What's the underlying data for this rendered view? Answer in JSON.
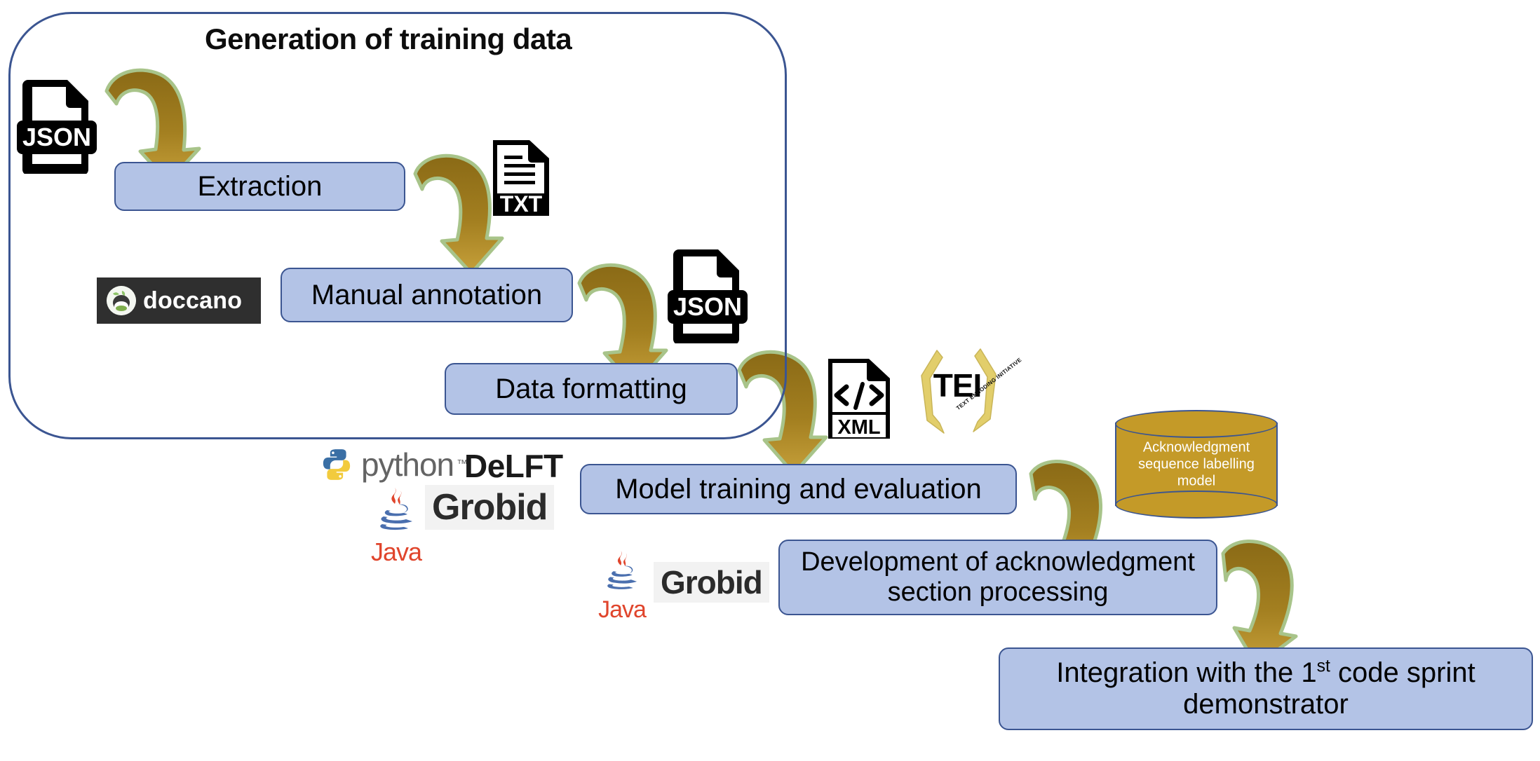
{
  "diagram": {
    "title": "Generation of training data",
    "group": {
      "label": "Generation of training data"
    },
    "steps": [
      {
        "id": "extraction",
        "label": "Extraction"
      },
      {
        "id": "manual-annotation",
        "label": "Manual annotation"
      },
      {
        "id": "data-formatting",
        "label": "Data formatting"
      },
      {
        "id": "model-training",
        "label": "Model training and evaluation"
      },
      {
        "id": "development",
        "label": "Development of acknowledgment section processing",
        "line1": "Development of acknowledgment",
        "line2": "section processing"
      },
      {
        "id": "integration",
        "label": "Integration with the 1st code sprint demonstrator",
        "line1_a": "Integration with the 1",
        "line1_sup": "st",
        "line1_b": " code sprint",
        "line2": "demonstrator"
      }
    ],
    "artifacts": [
      {
        "id": "json-input",
        "type": "file-icon",
        "label": "JSON"
      },
      {
        "id": "txt-file",
        "type": "file-icon",
        "label": "TXT"
      },
      {
        "id": "json-output",
        "type": "file-icon",
        "label": "JSON"
      },
      {
        "id": "xml-file",
        "type": "file-icon",
        "label": "XML"
      }
    ],
    "database": {
      "id": "ack-model",
      "line1": "Acknowledgment",
      "line2": "sequence labelling",
      "line3": "model"
    },
    "tools": [
      {
        "id": "doccano",
        "label": "doccano"
      },
      {
        "id": "python",
        "label": "python",
        "tm": "™"
      },
      {
        "id": "delft",
        "label": "DeLFT"
      },
      {
        "id": "grobid-1",
        "label": "Grobid"
      },
      {
        "id": "java-1",
        "label": "Java",
        "tm": "™"
      },
      {
        "id": "grobid-2",
        "label": "Grobid"
      },
      {
        "id": "java-2",
        "label": "Java",
        "tm": "™"
      },
      {
        "id": "tei",
        "label": "TEI",
        "sublabel": "TEXT ENCODING INITIATIVE"
      }
    ],
    "colors": {
      "box_fill": "#b3c3e6",
      "box_border": "#3b5591",
      "arrow_fill": "#9e7b1e",
      "arrow_outline": "#a8c48a",
      "cylinder_fill": "#c49a28",
      "frame_border": "#3b5591",
      "text": "#000000",
      "doccano_bg": "#2f2f2f",
      "java_red": "#e0452c",
      "java_blue": "#4a6fae",
      "python_blue": "#3a6fa5",
      "python_yellow": "#f2cb3e",
      "tei_gold": "#e2ce6b"
    }
  }
}
